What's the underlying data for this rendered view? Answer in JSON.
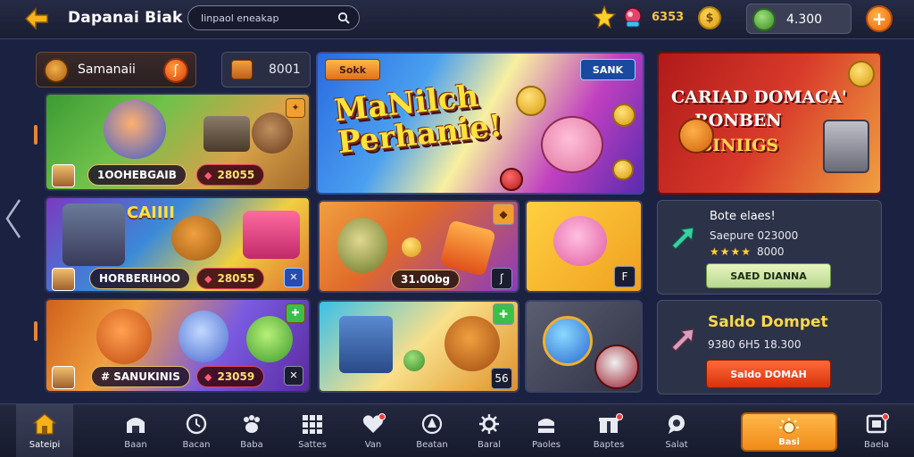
{
  "header": {
    "title": "Dapanai Biak",
    "search_placeholder": "Iinpaol eneakap",
    "gem_count": "6353",
    "balance": "4.300",
    "add_label": "+"
  },
  "left": {
    "category_label": "Samanaii",
    "category_badge": "ʃ",
    "count_label": "8001",
    "tiles": [
      {
        "chip": "1OOHEBGAIB",
        "prize": "28055"
      },
      {
        "chip": "HORBERIHOO",
        "prize": "28055"
      },
      {
        "chip": "SANUKINIS",
        "chip_prefix": "#",
        "prize": "23059"
      }
    ],
    "tile2_sign": "CAIIII"
  },
  "banner": {
    "tag_left": "Sokk",
    "tag_right": "SANK",
    "headline": "MaNilch Perhanie!"
  },
  "games": {
    "g1_pill": "31.00bg",
    "g1_corner": "ʃ",
    "g2_corner": "F",
    "g3_corner": "56"
  },
  "promo": {
    "line1": "CARIAD DOMACA'",
    "line2": "RONBEN",
    "line3": "BINIIGS"
  },
  "panel_a": {
    "head": "Bote elaes!",
    "sub": "Saepure 023000",
    "stars": "★★★★",
    "star_text": "8000",
    "action": "SAED DIANNA"
  },
  "panel_b": {
    "head": "Saldo Dompet",
    "sub": "9380 6H5 18.300",
    "action": "Saldo DOMAH"
  },
  "nav": [
    {
      "label": "Sateipi",
      "icon": "home-icon"
    },
    {
      "label": "Baan",
      "icon": "shop-icon"
    },
    {
      "label": "Bacan",
      "icon": "clock-icon"
    },
    {
      "label": "Baba",
      "icon": "paw-icon"
    },
    {
      "label": "Sattes",
      "icon": "grid-icon"
    },
    {
      "label": "Van",
      "icon": "heart-icon"
    },
    {
      "label": "Beatan",
      "icon": "shield-icon"
    },
    {
      "label": "Baral",
      "icon": "gear-icon"
    },
    {
      "label": "Paoles",
      "icon": "cake-icon"
    },
    {
      "label": "Baptes",
      "icon": "gift-icon"
    },
    {
      "label": "Salat",
      "icon": "chat-icon"
    },
    {
      "label": "Basi",
      "icon": "sun-icon"
    },
    {
      "label": "Baela",
      "icon": "mail-icon"
    }
  ],
  "colors": {
    "accent": "#f08a18",
    "bg": "#1b2140",
    "gold": "#ffd84a"
  }
}
